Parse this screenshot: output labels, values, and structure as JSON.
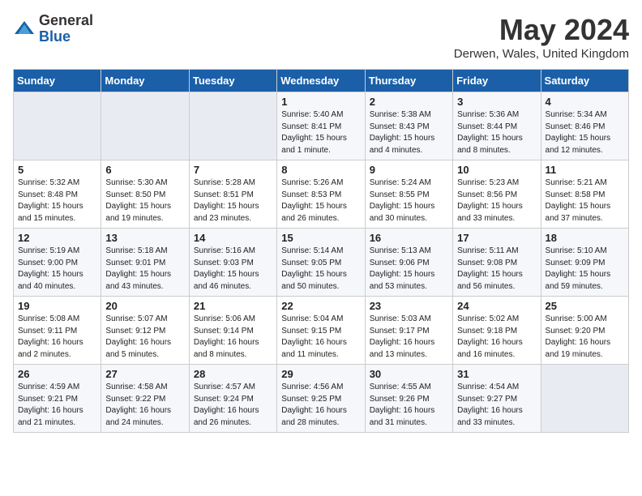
{
  "logo": {
    "general": "General",
    "blue": "Blue"
  },
  "title": "May 2024",
  "subtitle": "Derwen, Wales, United Kingdom",
  "days_of_week": [
    "Sunday",
    "Monday",
    "Tuesday",
    "Wednesday",
    "Thursday",
    "Friday",
    "Saturday"
  ],
  "weeks": [
    [
      {
        "day": "",
        "info": ""
      },
      {
        "day": "",
        "info": ""
      },
      {
        "day": "",
        "info": ""
      },
      {
        "day": "1",
        "info": "Sunrise: 5:40 AM\nSunset: 8:41 PM\nDaylight: 15 hours\nand 1 minute."
      },
      {
        "day": "2",
        "info": "Sunrise: 5:38 AM\nSunset: 8:43 PM\nDaylight: 15 hours\nand 4 minutes."
      },
      {
        "day": "3",
        "info": "Sunrise: 5:36 AM\nSunset: 8:44 PM\nDaylight: 15 hours\nand 8 minutes."
      },
      {
        "day": "4",
        "info": "Sunrise: 5:34 AM\nSunset: 8:46 PM\nDaylight: 15 hours\nand 12 minutes."
      }
    ],
    [
      {
        "day": "5",
        "info": "Sunrise: 5:32 AM\nSunset: 8:48 PM\nDaylight: 15 hours\nand 15 minutes."
      },
      {
        "day": "6",
        "info": "Sunrise: 5:30 AM\nSunset: 8:50 PM\nDaylight: 15 hours\nand 19 minutes."
      },
      {
        "day": "7",
        "info": "Sunrise: 5:28 AM\nSunset: 8:51 PM\nDaylight: 15 hours\nand 23 minutes."
      },
      {
        "day": "8",
        "info": "Sunrise: 5:26 AM\nSunset: 8:53 PM\nDaylight: 15 hours\nand 26 minutes."
      },
      {
        "day": "9",
        "info": "Sunrise: 5:24 AM\nSunset: 8:55 PM\nDaylight: 15 hours\nand 30 minutes."
      },
      {
        "day": "10",
        "info": "Sunrise: 5:23 AM\nSunset: 8:56 PM\nDaylight: 15 hours\nand 33 minutes."
      },
      {
        "day": "11",
        "info": "Sunrise: 5:21 AM\nSunset: 8:58 PM\nDaylight: 15 hours\nand 37 minutes."
      }
    ],
    [
      {
        "day": "12",
        "info": "Sunrise: 5:19 AM\nSunset: 9:00 PM\nDaylight: 15 hours\nand 40 minutes."
      },
      {
        "day": "13",
        "info": "Sunrise: 5:18 AM\nSunset: 9:01 PM\nDaylight: 15 hours\nand 43 minutes."
      },
      {
        "day": "14",
        "info": "Sunrise: 5:16 AM\nSunset: 9:03 PM\nDaylight: 15 hours\nand 46 minutes."
      },
      {
        "day": "15",
        "info": "Sunrise: 5:14 AM\nSunset: 9:05 PM\nDaylight: 15 hours\nand 50 minutes."
      },
      {
        "day": "16",
        "info": "Sunrise: 5:13 AM\nSunset: 9:06 PM\nDaylight: 15 hours\nand 53 minutes."
      },
      {
        "day": "17",
        "info": "Sunrise: 5:11 AM\nSunset: 9:08 PM\nDaylight: 15 hours\nand 56 minutes."
      },
      {
        "day": "18",
        "info": "Sunrise: 5:10 AM\nSunset: 9:09 PM\nDaylight: 15 hours\nand 59 minutes."
      }
    ],
    [
      {
        "day": "19",
        "info": "Sunrise: 5:08 AM\nSunset: 9:11 PM\nDaylight: 16 hours\nand 2 minutes."
      },
      {
        "day": "20",
        "info": "Sunrise: 5:07 AM\nSunset: 9:12 PM\nDaylight: 16 hours\nand 5 minutes."
      },
      {
        "day": "21",
        "info": "Sunrise: 5:06 AM\nSunset: 9:14 PM\nDaylight: 16 hours\nand 8 minutes."
      },
      {
        "day": "22",
        "info": "Sunrise: 5:04 AM\nSunset: 9:15 PM\nDaylight: 16 hours\nand 11 minutes."
      },
      {
        "day": "23",
        "info": "Sunrise: 5:03 AM\nSunset: 9:17 PM\nDaylight: 16 hours\nand 13 minutes."
      },
      {
        "day": "24",
        "info": "Sunrise: 5:02 AM\nSunset: 9:18 PM\nDaylight: 16 hours\nand 16 minutes."
      },
      {
        "day": "25",
        "info": "Sunrise: 5:00 AM\nSunset: 9:20 PM\nDaylight: 16 hours\nand 19 minutes."
      }
    ],
    [
      {
        "day": "26",
        "info": "Sunrise: 4:59 AM\nSunset: 9:21 PM\nDaylight: 16 hours\nand 21 minutes."
      },
      {
        "day": "27",
        "info": "Sunrise: 4:58 AM\nSunset: 9:22 PM\nDaylight: 16 hours\nand 24 minutes."
      },
      {
        "day": "28",
        "info": "Sunrise: 4:57 AM\nSunset: 9:24 PM\nDaylight: 16 hours\nand 26 minutes."
      },
      {
        "day": "29",
        "info": "Sunrise: 4:56 AM\nSunset: 9:25 PM\nDaylight: 16 hours\nand 28 minutes."
      },
      {
        "day": "30",
        "info": "Sunrise: 4:55 AM\nSunset: 9:26 PM\nDaylight: 16 hours\nand 31 minutes."
      },
      {
        "day": "31",
        "info": "Sunrise: 4:54 AM\nSunset: 9:27 PM\nDaylight: 16 hours\nand 33 minutes."
      },
      {
        "day": "",
        "info": ""
      }
    ]
  ]
}
